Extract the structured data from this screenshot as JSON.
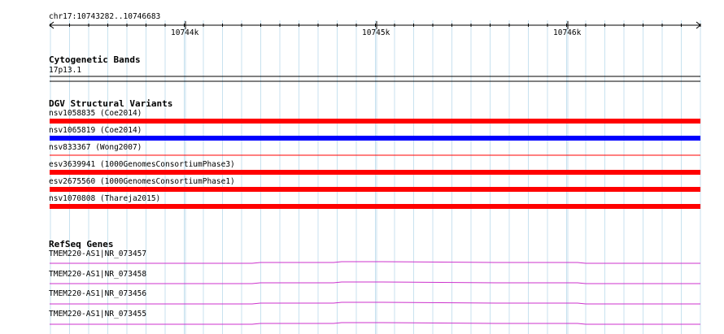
{
  "browser": {
    "region_label": "chr17:10743282..10746683",
    "ruler_ticks": [
      {
        "label": "10744k"
      },
      {
        "label": "10745k"
      },
      {
        "label": "10746k"
      }
    ],
    "colors": {
      "grid": "#c8e2ef",
      "gain": "#0000ff",
      "loss": "#ff0000",
      "gene": "#cc33cc",
      "axis": "#000000"
    }
  },
  "cytoband_track": {
    "title": "Cytogenetic Bands",
    "band_label": "17p13.1"
  },
  "dgv_track": {
    "title": "DGV Structural Variants",
    "features": [
      {
        "label": "nsv1058835 (Coe2014)",
        "type": "loss"
      },
      {
        "label": "nsv1065819 (Coe2014)",
        "type": "gain"
      },
      {
        "label": "nsv833367 (Wong2007)",
        "type": "loss-thin"
      },
      {
        "label": "esv3639941 (1000GenomesConsortiumPhase3)",
        "type": "loss"
      },
      {
        "label": "esv2675560 (1000GenomesConsortiumPhase1)",
        "type": "loss"
      },
      {
        "label": "nsv1070808 (Thareja2015)",
        "type": "loss"
      }
    ]
  },
  "refseq_track": {
    "title": "RefSeq Genes",
    "genes": [
      {
        "label": "TMEM220-AS1|NR_073457"
      },
      {
        "label": "TMEM220-AS1|NR_073458"
      },
      {
        "label": "TMEM220-AS1|NR_073456"
      },
      {
        "label": "TMEM220-AS1|NR_073455"
      }
    ]
  }
}
